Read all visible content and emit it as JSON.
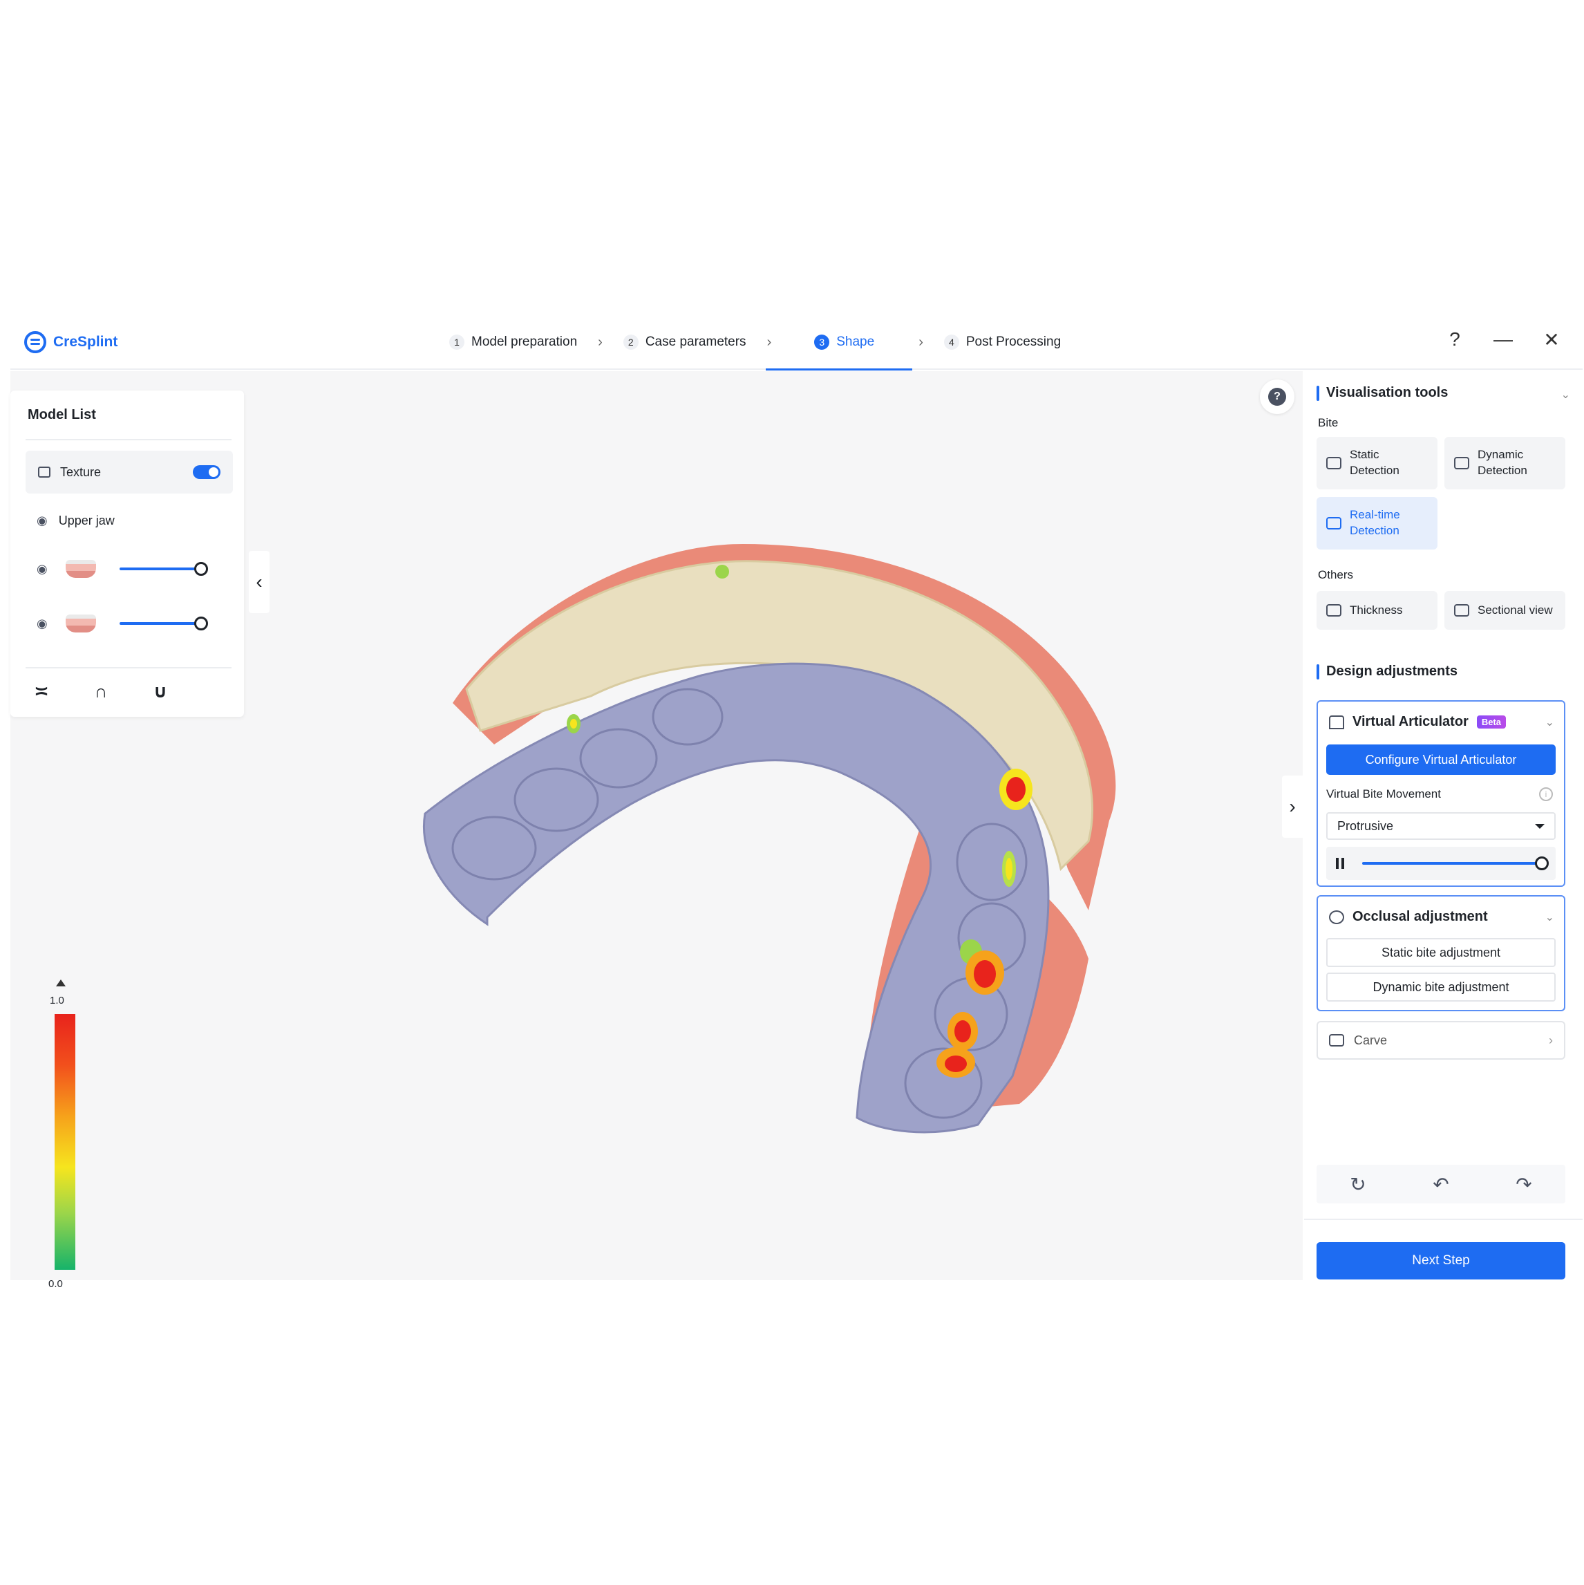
{
  "app": {
    "name": "CreSplint"
  },
  "steps": [
    {
      "num": "1",
      "label": "Model preparation"
    },
    {
      "num": "2",
      "label": "Case parameters"
    },
    {
      "num": "3",
      "label": "Shape"
    },
    {
      "num": "4",
      "label": "Post Processing"
    }
  ],
  "active_step": "3",
  "window_controls": {
    "help": "?",
    "minimize": "—",
    "close": "✕"
  },
  "model_list": {
    "title": "Model List",
    "texture_label": "Texture",
    "texture_on": true,
    "upper_jaw_label": "Upper jaw",
    "models": [
      {
        "opacity": 1.0
      },
      {
        "opacity": 1.0
      }
    ]
  },
  "viewport": {
    "help_icon": "?",
    "collapse_left": "‹",
    "collapse_right": "›"
  },
  "legend": {
    "max": "1.0",
    "min": "0.0"
  },
  "visualisation": {
    "title": "Visualisation tools",
    "bite_label": "Bite",
    "static_detection": "Static Detection",
    "dynamic_detection": "Dynamic Detection",
    "realtime_detection": "Real-time Detection",
    "others_label": "Others",
    "thickness": "Thickness",
    "sectional_view": "Sectional view"
  },
  "design": {
    "title": "Design adjustments",
    "virtual_articulator": "Virtual Articulator",
    "beta": "Beta",
    "configure_btn": "Configure Virtual Articulator",
    "bite_movement_label": "Virtual Bite Movement",
    "bite_movement_value": "Protrusive",
    "playback_position": 1.0,
    "occlusal_adjustment": "Occlusal adjustment",
    "static_bite_btn": "Static bite adjustment",
    "dynamic_bite_btn": "Dynamic bite adjustment",
    "carve": "Carve"
  },
  "history": {
    "reset": "↻",
    "undo": "↶",
    "redo": "↷"
  },
  "next_step": "Next Step",
  "colors": {
    "accent": "#1e6cf2",
    "jaw": "#9ea2c9",
    "gingiva": "#ea8a78",
    "splint": "#e9dfbf"
  }
}
